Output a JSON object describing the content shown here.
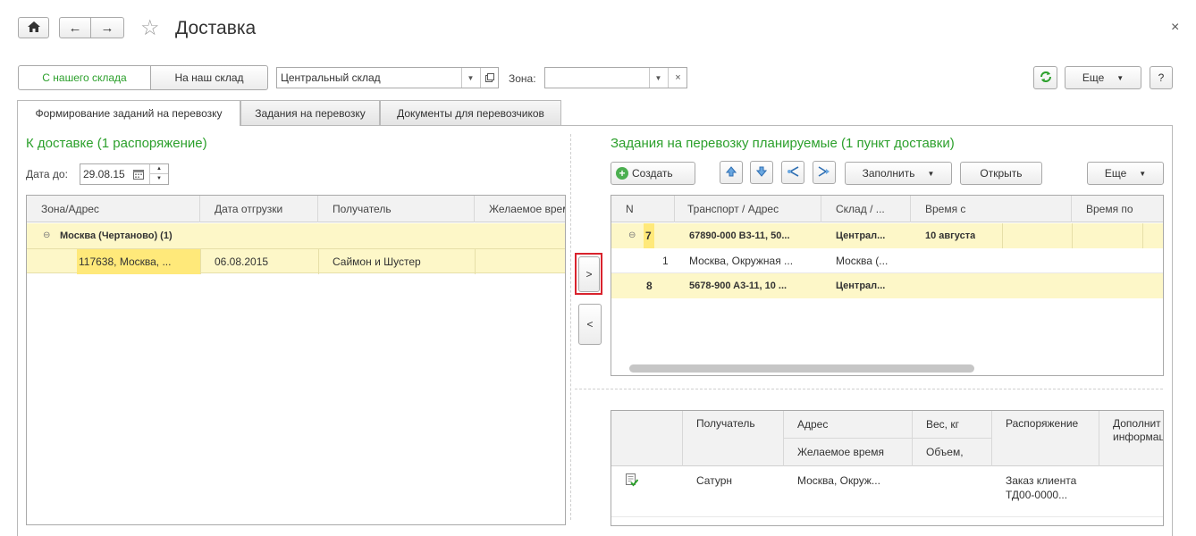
{
  "title": "Доставка",
  "toggle": {
    "from_our": "С нашего склада",
    "to_our": "На наш склад"
  },
  "warehouse": {
    "value": "Центральный склад"
  },
  "zone": {
    "label": "Зона:",
    "value": ""
  },
  "toolbar": {
    "more": "Еще",
    "help": "?"
  },
  "tabs": [
    {
      "label": "Формирование заданий на перевозку"
    },
    {
      "label": "Задания на перевозку"
    },
    {
      "label": "Документы для перевозчиков"
    }
  ],
  "left": {
    "title": "К доставке (1 распоряжение)",
    "date_label": "Дата до:",
    "date_value": "29.08.15",
    "columns": [
      "Зона/Адрес",
      "Дата отгрузки",
      "Получатель",
      "Желаемое время"
    ],
    "group": {
      "label": "Москва (Чертаново) (1)"
    },
    "rows": [
      {
        "address": "117638, Москва, ...",
        "date": "06.08.2015",
        "receiver": "Саймон и Шустер",
        "time": ""
      }
    ]
  },
  "move": {
    "right": ">",
    "left": "<"
  },
  "right": {
    "title": "Задания на перевозку планируемые (1 пункт доставки)",
    "create": "Создать",
    "fill": "Заполнить",
    "open": "Открыть",
    "more": "Еще",
    "columns": [
      "N",
      "Транспорт / Адрес",
      "Склад / ...",
      "Время с",
      "Время по"
    ],
    "rows": [
      {
        "n": "7",
        "transport": "67890-000 B3-11, 50...",
        "warehouse": "Централ...",
        "time_from": "10 августа",
        "bold": true
      },
      {
        "n": "1",
        "transport": "Москва, Окружная ...",
        "warehouse": "Москва (...",
        "time_from": "",
        "bold": false
      },
      {
        "n": "8",
        "transport": "5678-900 A3-11, 10 ...",
        "warehouse": "Централ...",
        "time_from": "",
        "bold": true
      }
    ]
  },
  "bottom": {
    "columns": {
      "receiver": "Получатель",
      "address": "Адрес",
      "desired_time": "Желаемое время",
      "weight": "Вес, кг",
      "volume": "Объем,",
      "order": "Распоряжение",
      "extra": "Дополнит информац"
    },
    "row": {
      "receiver": "Сатурн",
      "address": "Москва, Окруж...",
      "order_line1": "Заказ клиента",
      "order_line2": "ТД00-0000..."
    }
  },
  "colors": {
    "accent_green": "#2ca02c",
    "highlight": "#fdf7c8",
    "selected": "#ffe97a",
    "focus_red": "#d9232d"
  }
}
